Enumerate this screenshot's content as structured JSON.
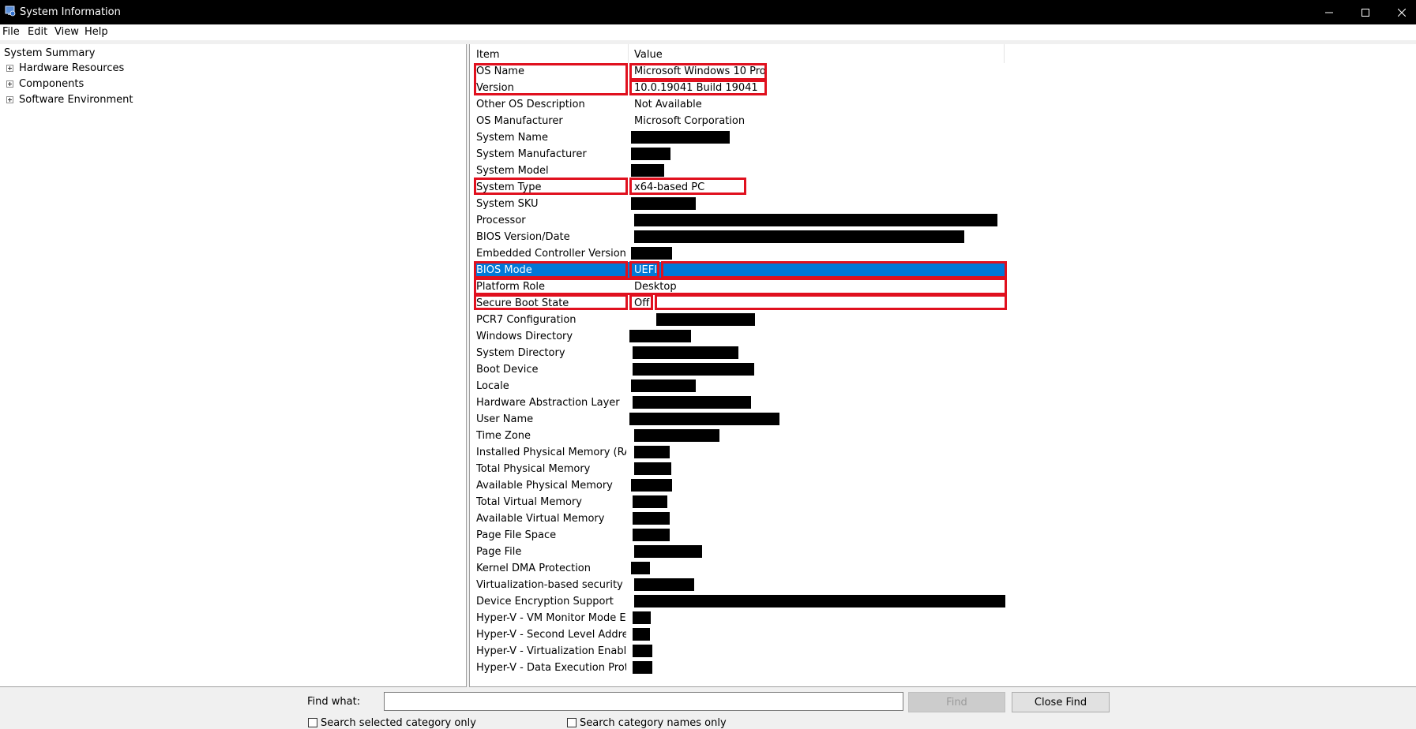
{
  "window": {
    "title": "System Information",
    "icon": "system-info-icon",
    "controls": [
      "minimize-icon",
      "maximize-icon",
      "close-icon"
    ]
  },
  "menu": [
    "File",
    "Edit",
    "View",
    "Help"
  ],
  "tree": {
    "root": "System Summary",
    "children": [
      "Hardware Resources",
      "Components",
      "Software Environment"
    ]
  },
  "list": {
    "headers": {
      "item": "Item",
      "value": "Value"
    },
    "rows": [
      {
        "item": "OS Name",
        "value": "Microsoft Windows 10 Pro"
      },
      {
        "item": "Version",
        "value": "10.0.19041 Build 19041"
      },
      {
        "item": "Other OS Description",
        "value": "Not Available"
      },
      {
        "item": "OS Manufacturer",
        "value": "Microsoft Corporation"
      },
      {
        "item": "System Name",
        "value": ""
      },
      {
        "item": "System Manufacturer",
        "value": ""
      },
      {
        "item": "System Model",
        "value": ""
      },
      {
        "item": "System Type",
        "value": "x64-based PC"
      },
      {
        "item": "System SKU",
        "value": ""
      },
      {
        "item": "Processor",
        "value": ""
      },
      {
        "item": "BIOS Version/Date",
        "value": ""
      },
      {
        "item": "Embedded Controller Version",
        "value": ""
      },
      {
        "item": "BIOS Mode",
        "value": "UEFI",
        "selected": true
      },
      {
        "item": "Platform Role",
        "value": "Desktop"
      },
      {
        "item": "Secure Boot State",
        "value": "Off"
      },
      {
        "item": "PCR7 Configuration",
        "value": ""
      },
      {
        "item": "Windows Directory",
        "value": ""
      },
      {
        "item": "System Directory",
        "value": ""
      },
      {
        "item": "Boot Device",
        "value": ""
      },
      {
        "item": "Locale",
        "value": ""
      },
      {
        "item": "Hardware Abstraction Layer",
        "value": ""
      },
      {
        "item": "User Name",
        "value": ""
      },
      {
        "item": "Time Zone",
        "value": ""
      },
      {
        "item": "Installed Physical Memory (RAM)",
        "value": ""
      },
      {
        "item": "Total Physical Memory",
        "value": ""
      },
      {
        "item": "Available Physical Memory",
        "value": ""
      },
      {
        "item": "Total Virtual Memory",
        "value": ""
      },
      {
        "item": "Available Virtual Memory",
        "value": ""
      },
      {
        "item": "Page File Space",
        "value": ""
      },
      {
        "item": "Page File",
        "value": ""
      },
      {
        "item": "Kernel DMA Protection",
        "value": ""
      },
      {
        "item": "Virtualization-based security",
        "value": ""
      },
      {
        "item": "Device Encryption Support",
        "value": ""
      },
      {
        "item": "Hyper-V - VM Monitor Mode E...",
        "value": ""
      },
      {
        "item": "Hyper-V - Second Level Addres...",
        "value": ""
      },
      {
        "item": "Hyper-V - Virtualization Enable...",
        "value": ""
      },
      {
        "item": "Hyper-V - Data Execution Prote...",
        "value": ""
      }
    ]
  },
  "find": {
    "label": "Find what:",
    "value": "",
    "find_button": "Find",
    "close_button": "Close Find",
    "option_selected_category": "Search selected category only",
    "option_category_names": "Search category names only"
  },
  "colors": {
    "selection": "#0078d7",
    "highlight_box": "#e0101e",
    "titlebar": "#000000"
  }
}
